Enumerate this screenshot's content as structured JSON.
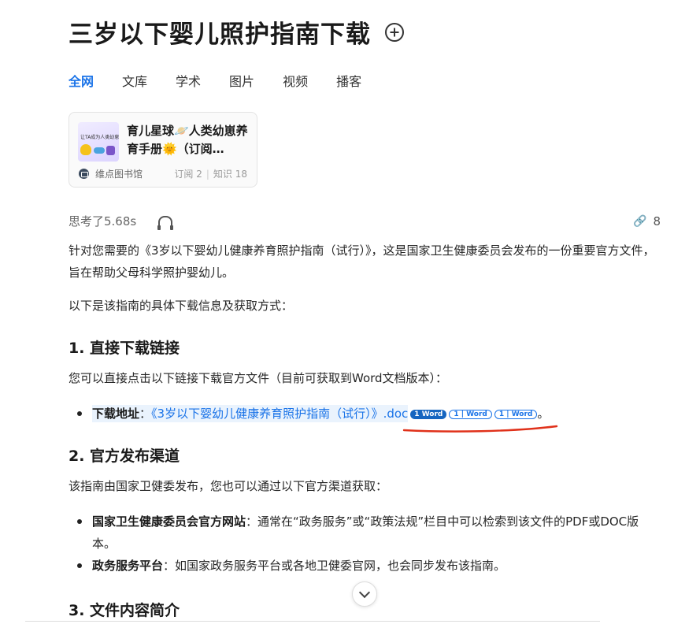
{
  "page": {
    "title": "三岁以下婴儿照护指南下载"
  },
  "tabs": [
    "全网",
    "文库",
    "学术",
    "图片",
    "视频",
    "播客"
  ],
  "card": {
    "title": "育儿星球🪐人类幼崽养育手册🌞（订阅…",
    "thumb_text": "让TA成为人类幼崽养育专家",
    "source": "维点图书馆",
    "subscribe": "订阅 2",
    "knowledge": "知识 18"
  },
  "think": {
    "label": "思考了5.68s",
    "share_count": "8"
  },
  "content": {
    "intro": "针对您需要的《3岁以下婴幼儿健康养育照护指南（试行）》，这是国家卫生健康委员会发布的一份重要官方文件，旨在帮助父母科学照护婴幼儿。",
    "intro2": "以下是该指南的具体下载信息及获取方式：",
    "section1": {
      "heading": "1. 直接下载链接",
      "desc": "您可以直接点击以下链接下载官方文件（目前可获取到Word文档版本）：",
      "item_label": "下载地址",
      "item_colon": "：",
      "link_text": "《3岁以下婴幼儿健康养育照护指南（试行）》.doc",
      "badges": [
        "1 Word",
        "1 | Word",
        "1 | Word"
      ],
      "end": "。"
    },
    "section2": {
      "heading": "2. 官方发布渠道",
      "desc": "该指南由国家卫健委发布，您也可以通过以下官方渠道获取：",
      "items": [
        {
          "label": "国家卫生健康委员会官方网站",
          "text": "：通常在“政务服务”或“政策法规”栏目中可以检索到该文件的PDF或DOC版本。"
        },
        {
          "label": "政务服务平台",
          "text": "：如国家政务服务平台或各地卫健委官网，也会同步发布该指南。"
        }
      ]
    },
    "section3": {
      "heading": "3. 文件内容简介"
    }
  },
  "annotation": {
    "color": "#e0311a"
  },
  "icons": {
    "add": "add-circle-icon",
    "headphone": "headphone-icon",
    "link": "link-icon",
    "expand": "chevron-down-icon"
  }
}
